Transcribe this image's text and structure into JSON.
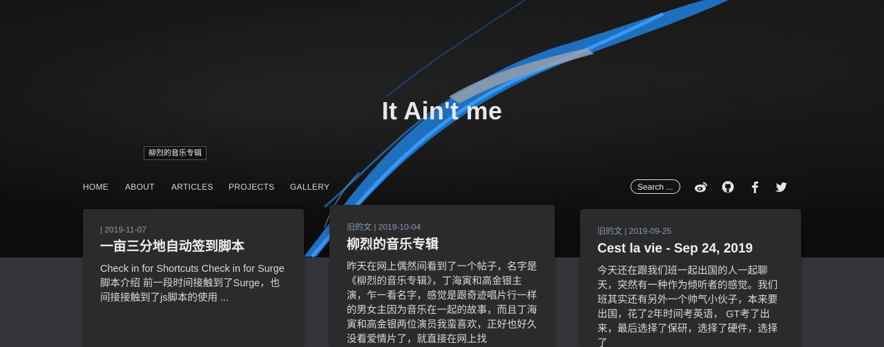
{
  "site": {
    "title": "It Ain't me"
  },
  "tooltip": "柳烈的音乐专辑",
  "nav": [
    {
      "label": "HOME"
    },
    {
      "label": "ABOUT"
    },
    {
      "label": "ARTICLES"
    },
    {
      "label": "PROJECTS"
    },
    {
      "label": "GALLERY"
    }
  ],
  "search": {
    "placeholder": "Search ..."
  },
  "social": [
    "weibo-icon",
    "github-icon",
    "facebook-icon",
    "twitter-icon"
  ],
  "posts": [
    {
      "meta": "| 2019-11-07",
      "title": "一亩三分地自动签到脚本",
      "excerpt": "Check in for Shortcuts Check in for Surge 脚本介绍 前一段时间接触到了Surge，也间接接触到了js脚本的使用 ..."
    },
    {
      "meta": "旧的文 | 2019-10-04",
      "title": "柳烈的音乐专辑",
      "excerpt": "昨天在网上偶然间看到了一个帖子，名字是《柳烈的音乐专辑》，丁海寅和高金银主演，乍一看名字，感觉是跟奇迹唱片行一样的男女主因为音乐在一起的故事，而且丁海寅和高金银两位演员我蛮喜欢，正好也好久没看爱情片了，就直接在网上找"
    },
    {
      "meta": "旧的文 | 2019-09-25",
      "title": "Cest la vie - Sep 24, 2019",
      "excerpt": "今天还在跟我们班一起出国的人一起聊天，突然有一种作为倾听者的感觉。我们班其实还有另外一个帅气小伙子，本来要出国，花了2年时间考英语， GT考了出来，最后选择了保研，选择了硬件，选择了"
    }
  ]
}
